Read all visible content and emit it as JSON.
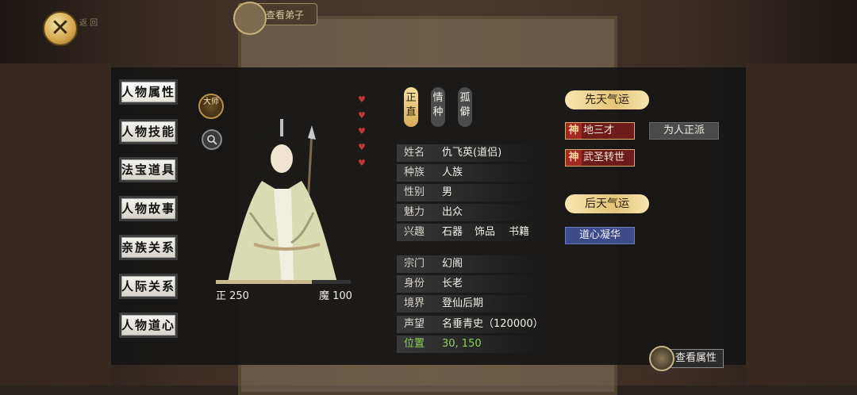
{
  "top": {
    "close_icon": "close-x-icon",
    "close_label": "返 回",
    "bg_tab_label": "查看弟子"
  },
  "menu": {
    "items": [
      {
        "label": "人物属性",
        "active": true
      },
      {
        "label": "人物技能"
      },
      {
        "label": "法宝道具"
      },
      {
        "label": "人物故事"
      },
      {
        "label": "亲族关系"
      },
      {
        "label": "人际关系"
      },
      {
        "label": "人物道心"
      }
    ]
  },
  "badge": {
    "label": "大师",
    "icon": "master-badge-icon"
  },
  "search_icon": "magnifier-icon",
  "portrait": {
    "zheng_label": "正 250",
    "mo_label": "魔 100",
    "moral_ratio": 0.71,
    "hearts": 5
  },
  "traits": [
    {
      "text": "正直",
      "style": "gold"
    },
    {
      "text": "情种",
      "style": "gray"
    },
    {
      "text": "孤僻",
      "style": "gray"
    }
  ],
  "info": {
    "name": {
      "key": "姓名",
      "value": "仇飞英(道侣)"
    },
    "race": {
      "key": "种族",
      "value": "人族"
    },
    "gender": {
      "key": "性别",
      "value": "男"
    },
    "charm": {
      "key": "魅力",
      "value": "出众"
    },
    "hobby": {
      "key": "兴趣",
      "values": [
        "石器",
        "饰品",
        "书籍"
      ]
    },
    "sect": {
      "key": "宗门",
      "value": "幻阁"
    },
    "identity": {
      "key": "身份",
      "value": "长老"
    },
    "realm": {
      "key": "境界",
      "value": "登仙后期"
    },
    "fame": {
      "key": "声望",
      "value": "名垂青史（120000）"
    },
    "position": {
      "key": "位置",
      "value": "30, 150"
    }
  },
  "luck": {
    "innate_title": "先天气运",
    "innate_tags": [
      {
        "mark": "神",
        "text": "地三才"
      },
      {
        "mark": "神",
        "text": "武圣转世"
      }
    ],
    "innate_gray": "为人正派",
    "acquired_title": "后天气运",
    "acquired_tags": [
      {
        "text": "道心凝华"
      }
    ]
  },
  "view_attr_button": {
    "label": "查看属性",
    "icon": "character-avatar-icon"
  },
  "colors": {
    "panel": "#161616",
    "gold": "#e4c478",
    "green": "#8fd05a",
    "heart": "#c0383a"
  }
}
